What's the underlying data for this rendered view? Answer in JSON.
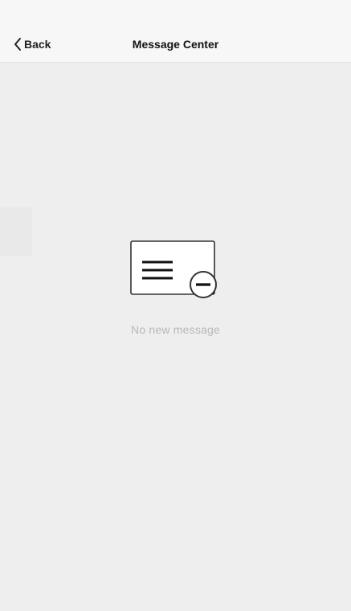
{
  "navbar": {
    "back_label": "Back",
    "title": "Message Center",
    "back_icon": "chevron-left-icon"
  },
  "empty_state": {
    "icon": "envelope-minus-icon",
    "message": "No new message"
  },
  "colors": {
    "navbar_bg": "#f7f7f7",
    "content_bg": "#eeeeee",
    "text_primary": "#111111",
    "text_muted": "#b8b8b8"
  }
}
